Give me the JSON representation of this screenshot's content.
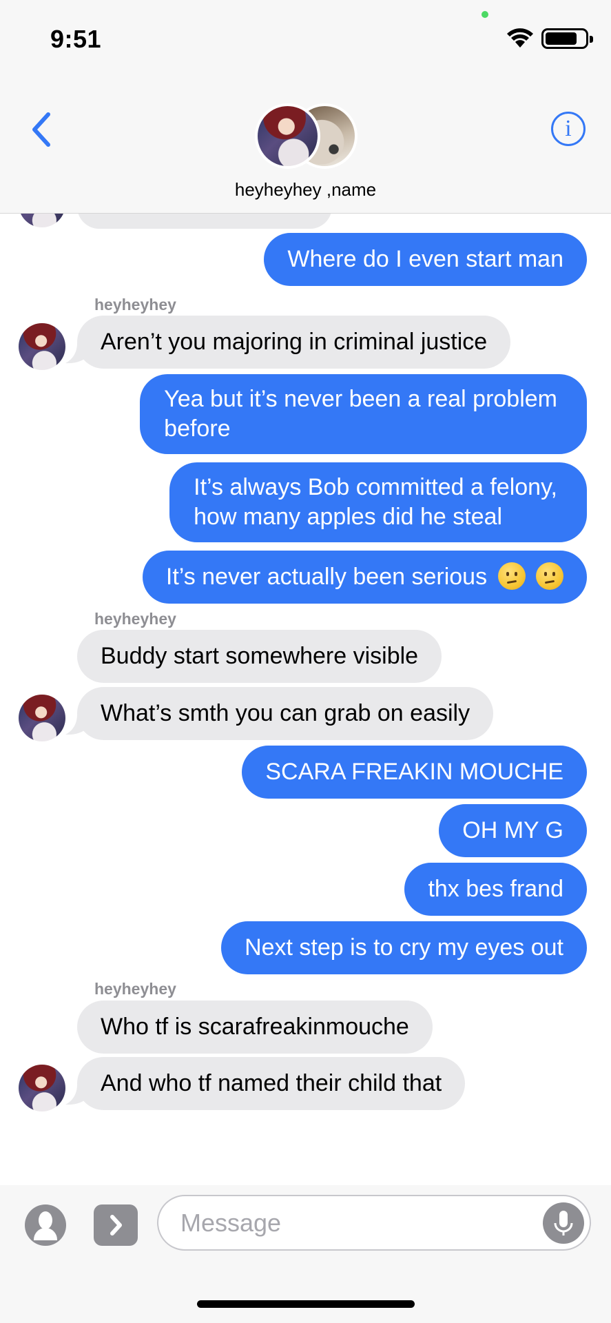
{
  "status": {
    "time": "9:51"
  },
  "header": {
    "conversation_name": "heyheyhey ,name"
  },
  "messages": [
    {
      "text": "Where do I even start man"
    },
    {
      "sender": "heyheyhey",
      "text": "Aren’t you majoring in criminal justice"
    },
    {
      "text1": "Yea but it’s never been a real problem",
      "text2": "before"
    },
    {
      "text1": "It’s always Bob committed a felony,",
      "text2": "how many apples did he steal"
    },
    {
      "text": "It’s never actually been serious",
      "emoji": "confused-face"
    },
    {
      "sender": "heyheyhey",
      "text": "Buddy start somewhere visible"
    },
    {
      "text": "What’s smth you can grab on easily"
    },
    {
      "text": "SCARA FREAKIN MOUCHE"
    },
    {
      "text": "OH MY G"
    },
    {
      "text": "thx bes frand"
    },
    {
      "text": "Next step is to cry my eyes out"
    },
    {
      "sender": "heyheyhey",
      "text": "Who tf is scarafreakinmouche"
    },
    {
      "text": "And who tf named their child that"
    }
  ],
  "composer": {
    "placeholder": "Message"
  },
  "colors": {
    "accent": "#3478f6",
    "incoming_bubble": "#e9e9eb",
    "header_bg": "#f7f7f7"
  }
}
